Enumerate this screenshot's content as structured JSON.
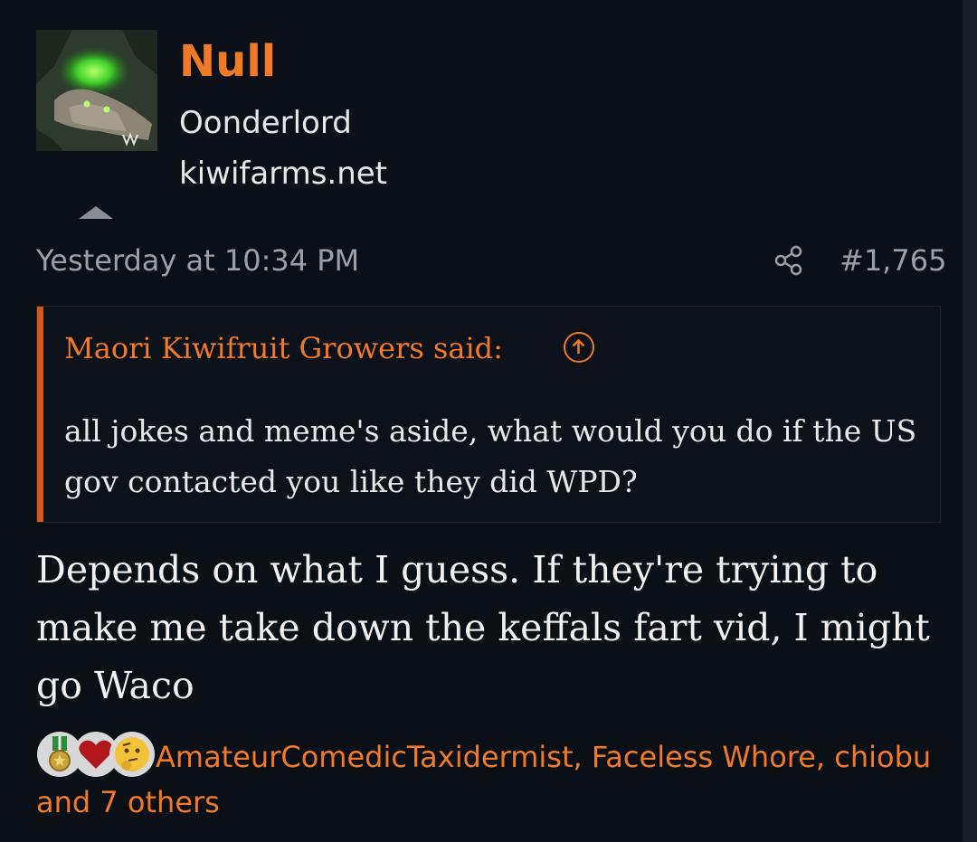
{
  "user": {
    "name": "Null",
    "title": "Oonderlord",
    "site": "kiwifarms.net"
  },
  "post": {
    "timestamp": "Yesterday at 10:34 PM",
    "number": "#1,765"
  },
  "quote": {
    "author_label": "Maori Kiwifruit Growers said:",
    "text": "all jokes and meme's aside, what would you do if the US gov contacted you like they did WPD?"
  },
  "message": {
    "text": "Depends on what I guess. If they're trying to make me take down the keffals fart vid, I might go Waco"
  },
  "reactions": {
    "icons": [
      "medal-icon",
      "heart-icon",
      "thinking-face-icon"
    ],
    "text": "AmateurComedicTaxidermist, Faceless Whore, chiobu and 7 others"
  },
  "colors": {
    "accent": "#f07a28",
    "quote_bar": "#d9571c",
    "background": "#0b0f16",
    "muted_text": "#9aa0a8"
  }
}
